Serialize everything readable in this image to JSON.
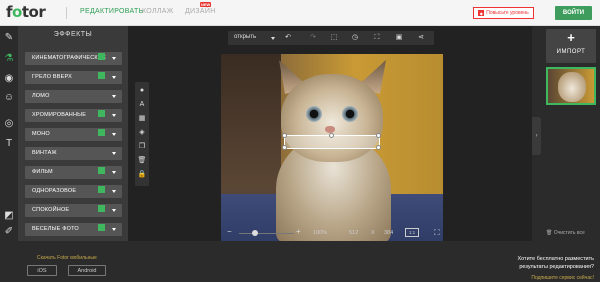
{
  "topbar": {
    "logo_pre": "f",
    "logo_o": "o",
    "logo_post": "tor",
    "nav_edit": "РЕДАКТИРОВАТЬ",
    "nav_collage": "КОЛЛАЖ",
    "nav_design": "ДИЗАЙН",
    "new_badge": "NEW",
    "upgrade_label": "Повысьте уровень",
    "login_label": "ВОЙТИ"
  },
  "effects": {
    "title": "ЭФФЕКТЫ",
    "items": [
      {
        "label": "КИНЕМАТОГРАФИЧЕСКОЕ",
        "premium": true
      },
      {
        "label": "ГРЕЛО ВВЕРХ",
        "premium": true
      },
      {
        "label": "ЛОМО",
        "premium": false
      },
      {
        "label": "ХРОМИРОВАННЫЕ",
        "premium": true
      },
      {
        "label": "МОНО",
        "premium": true
      },
      {
        "label": "ВИНТАЖ",
        "premium": false
      },
      {
        "label": "ФИЛЬМ",
        "premium": true
      },
      {
        "label": "ОДНОРАЗОВОЕ",
        "premium": true
      },
      {
        "label": "СПОКОЙНОЕ",
        "premium": true
      },
      {
        "label": "ВЕСЕЛЫЕ ФОТО",
        "premium": true
      }
    ]
  },
  "bottom_left": {
    "mobile_label": "Скачать Fotor мобильные",
    "ios": "iOS",
    "android": "Android"
  },
  "canvas": {
    "open_label": "открыть",
    "zoom_percent": "100%",
    "width": "512",
    "x": "X",
    "height": "384",
    "fit_label": "1:1"
  },
  "right_panel": {
    "import_label": "ИМПОРТ",
    "clear_label": "Очистить все"
  },
  "promo": {
    "text": "Хотите бесплатно разместить результаты редактирования?",
    "link": "Подпишите сервис сейчас!"
  },
  "colors": {
    "accent": "#3fb75f",
    "upgrade": "#e33333",
    "login": "#3e9c5c",
    "panel": "#3a3a3a",
    "background": "#2b2b2b"
  }
}
